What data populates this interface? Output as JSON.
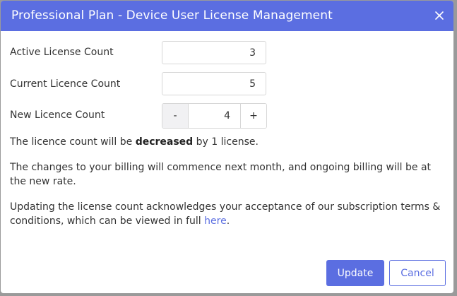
{
  "dialog": {
    "title": "Professional Plan - Device User License Management",
    "close_icon": "close-icon"
  },
  "fields": {
    "active": {
      "label": "Active License Count",
      "value": "3"
    },
    "current": {
      "label": "Current Licence Count",
      "value": "5"
    },
    "new": {
      "label": "New Licence Count",
      "value": "4",
      "minus": "-",
      "plus": "+"
    }
  },
  "messages": {
    "change_prefix": "The licence count will be ",
    "change_word": "decreased",
    "change_suffix": " by 1 license.",
    "billing": "The changes to your billing will commence next month, and ongoing billing will be at the new rate.",
    "terms_prefix": "Updating the license count acknowledges your acceptance of our subscription terms & conditions, which can be viewed in full ",
    "terms_link": "here",
    "terms_suffix": "."
  },
  "actions": {
    "update_label": "Update",
    "cancel_label": "Cancel"
  },
  "colors": {
    "accent": "#5b6ee1",
    "backdrop": "#9a9a9a"
  }
}
